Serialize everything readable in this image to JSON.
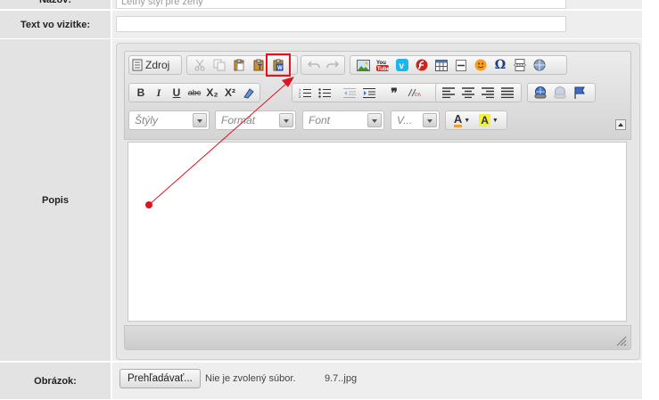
{
  "form": {
    "row_nazov": {
      "label": "Názov:",
      "value": "Letný štýl pre ženy"
    },
    "row_text": {
      "label": "Text vo vizitke:",
      "value": ""
    },
    "row_popis": {
      "label": "Popis"
    },
    "row_obrazok": {
      "label": "Obrázok:",
      "browse_label": "Prehľadávať...",
      "status": "Nie je zvolený súbor.",
      "current_file": "9.7..jpg"
    }
  },
  "toolbar": {
    "source_label": "Zdroj",
    "styles_placeholder": "Štýly",
    "format_placeholder": "Formát",
    "font_placeholder": "Font",
    "size_placeholder": "V...",
    "bold_label": "B",
    "italic_label": "I",
    "underline_label": "U",
    "strike_label": "abc",
    "subscript_label": "X₂",
    "superscript_label": "X²",
    "text_color_label": "A",
    "bg_color_label": "A",
    "quote_label": "❞",
    "special_char_label": "Ω"
  },
  "annotation": {
    "highlighted_button": "paste-from-word-button",
    "color": "#d91e26"
  },
  "colors": {
    "label_bg": "#e3e3e3",
    "value_bg": "#eeeeee",
    "highlight": "#e0141e"
  }
}
